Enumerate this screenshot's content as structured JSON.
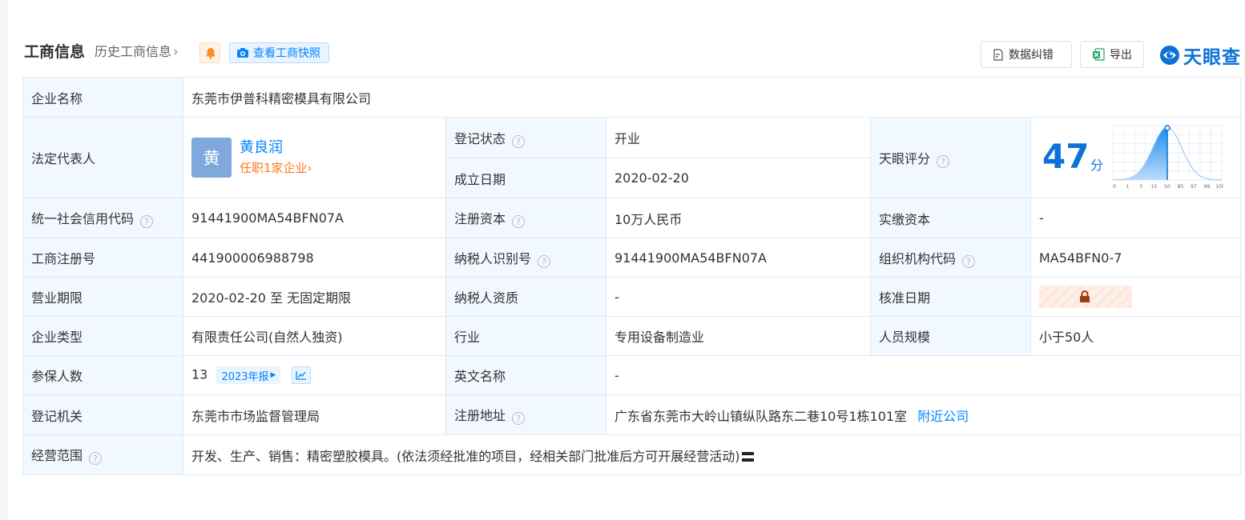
{
  "header": {
    "title": "工商信息",
    "history_link": "历史工商信息",
    "snapshot_button": "查看工商快照",
    "correction_button": "数据纠错",
    "export_button": "导出",
    "brand": "天眼查"
  },
  "icons": {
    "bell": "bell-icon",
    "camera": "camera-icon",
    "correction": "document-edit-icon",
    "export": "excel-icon",
    "brand": "tianyancha-logo-icon",
    "help": "question-circle-icon",
    "lock": "lock-icon",
    "trend": "trend-chart-icon"
  },
  "colors": {
    "accent": "#0084ff",
    "label_bg": "#f2f8ff",
    "status_green": "#0a9c4f",
    "orange": "#ff7a1a",
    "brand_blue": "#0a72d8",
    "avatar_bg": "#7ea9da"
  },
  "labels": {
    "company_name": "企业名称",
    "legal_rep": "法定代表人",
    "reg_status": "登记状态",
    "est_date": "成立日期",
    "tianyan_score": "天眼评分",
    "credit_code": "统一社会信用代码",
    "reg_capital": "注册资本",
    "paid_capital": "实缴资本",
    "reg_number": "工商注册号",
    "taxpayer_id": "纳税人识别号",
    "org_code": "组织机构代码",
    "biz_term": "营业期限",
    "taxpayer_qual": "纳税人资质",
    "approval_date": "核准日期",
    "company_type": "企业类型",
    "industry": "行业",
    "staff_size": "人员规模",
    "insured": "参保人数",
    "english_name": "英文名称",
    "reg_authority": "登记机关",
    "reg_address": "注册地址",
    "biz_scope": "经营范围"
  },
  "values": {
    "company_name": "东莞市伊普科精密模具有限公司",
    "legal_rep_avatar": "黄",
    "legal_rep_name": "黄良润",
    "legal_rep_roles": "任职1家企业",
    "reg_status": "开业",
    "est_date": "2020-02-20",
    "score": "47",
    "score_unit": "分",
    "credit_code": "91441900MA54BFN07A",
    "reg_capital": "10万人民币",
    "paid_capital": "-",
    "reg_number": "441900006988798",
    "taxpayer_id": "91441900MA54BFN07A",
    "org_code": "MA54BFN0-7",
    "biz_term": "2020-02-20 至 无固定期限",
    "taxpayer_qual": "-",
    "company_type": "有限责任公司(自然人独资)",
    "industry": "专用设备制造业",
    "staff_size": "小于50人",
    "insured": "13",
    "insured_report": "2023年报",
    "english_name": "-",
    "reg_authority": "东莞市市场监督管理局",
    "reg_address": "广东省东莞市大岭山镇纵队路东二巷10号1栋101室",
    "nearby_link": "附近公司",
    "biz_scope": "开发、生产、销售：精密塑胶模具。(依法须经批准的项目，经相关部门批准后方可开展经营活动)"
  },
  "score_chart": {
    "type": "area",
    "x_ticks": [
      "0",
      "1",
      "3",
      "15",
      "50",
      "85",
      "97",
      "99",
      "100"
    ],
    "marker_tick": "50",
    "value": 47
  }
}
